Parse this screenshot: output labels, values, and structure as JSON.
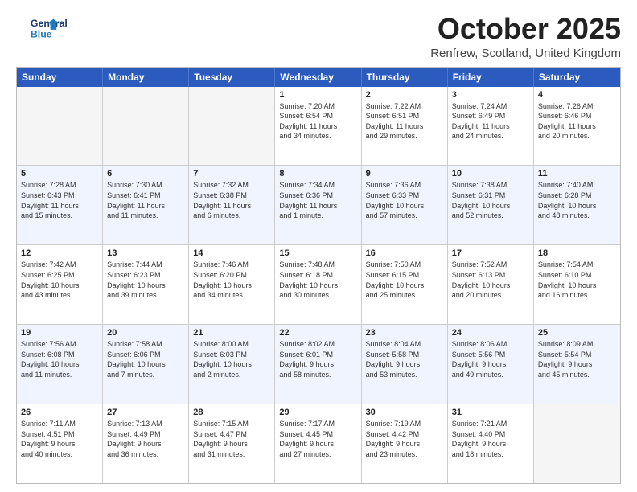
{
  "header": {
    "logo_line1": "General",
    "logo_line2": "Blue",
    "month": "October 2025",
    "location": "Renfrew, Scotland, United Kingdom"
  },
  "weekdays": [
    "Sunday",
    "Monday",
    "Tuesday",
    "Wednesday",
    "Thursday",
    "Friday",
    "Saturday"
  ],
  "rows": [
    [
      {
        "day": "",
        "info": ""
      },
      {
        "day": "",
        "info": ""
      },
      {
        "day": "",
        "info": ""
      },
      {
        "day": "1",
        "info": "Sunrise: 7:20 AM\nSunset: 6:54 PM\nDaylight: 11 hours\nand 34 minutes."
      },
      {
        "day": "2",
        "info": "Sunrise: 7:22 AM\nSunset: 6:51 PM\nDaylight: 11 hours\nand 29 minutes."
      },
      {
        "day": "3",
        "info": "Sunrise: 7:24 AM\nSunset: 6:49 PM\nDaylight: 11 hours\nand 24 minutes."
      },
      {
        "day": "4",
        "info": "Sunrise: 7:26 AM\nSunset: 6:46 PM\nDaylight: 11 hours\nand 20 minutes."
      }
    ],
    [
      {
        "day": "5",
        "info": "Sunrise: 7:28 AM\nSunset: 6:43 PM\nDaylight: 11 hours\nand 15 minutes."
      },
      {
        "day": "6",
        "info": "Sunrise: 7:30 AM\nSunset: 6:41 PM\nDaylight: 11 hours\nand 11 minutes."
      },
      {
        "day": "7",
        "info": "Sunrise: 7:32 AM\nSunset: 6:38 PM\nDaylight: 11 hours\nand 6 minutes."
      },
      {
        "day": "8",
        "info": "Sunrise: 7:34 AM\nSunset: 6:36 PM\nDaylight: 11 hours\nand 1 minute."
      },
      {
        "day": "9",
        "info": "Sunrise: 7:36 AM\nSunset: 6:33 PM\nDaylight: 10 hours\nand 57 minutes."
      },
      {
        "day": "10",
        "info": "Sunrise: 7:38 AM\nSunset: 6:31 PM\nDaylight: 10 hours\nand 52 minutes."
      },
      {
        "day": "11",
        "info": "Sunrise: 7:40 AM\nSunset: 6:28 PM\nDaylight: 10 hours\nand 48 minutes."
      }
    ],
    [
      {
        "day": "12",
        "info": "Sunrise: 7:42 AM\nSunset: 6:25 PM\nDaylight: 10 hours\nand 43 minutes."
      },
      {
        "day": "13",
        "info": "Sunrise: 7:44 AM\nSunset: 6:23 PM\nDaylight: 10 hours\nand 39 minutes."
      },
      {
        "day": "14",
        "info": "Sunrise: 7:46 AM\nSunset: 6:20 PM\nDaylight: 10 hours\nand 34 minutes."
      },
      {
        "day": "15",
        "info": "Sunrise: 7:48 AM\nSunset: 6:18 PM\nDaylight: 10 hours\nand 30 minutes."
      },
      {
        "day": "16",
        "info": "Sunrise: 7:50 AM\nSunset: 6:15 PM\nDaylight: 10 hours\nand 25 minutes."
      },
      {
        "day": "17",
        "info": "Sunrise: 7:52 AM\nSunset: 6:13 PM\nDaylight: 10 hours\nand 20 minutes."
      },
      {
        "day": "18",
        "info": "Sunrise: 7:54 AM\nSunset: 6:10 PM\nDaylight: 10 hours\nand 16 minutes."
      }
    ],
    [
      {
        "day": "19",
        "info": "Sunrise: 7:56 AM\nSunset: 6:08 PM\nDaylight: 10 hours\nand 11 minutes."
      },
      {
        "day": "20",
        "info": "Sunrise: 7:58 AM\nSunset: 6:06 PM\nDaylight: 10 hours\nand 7 minutes."
      },
      {
        "day": "21",
        "info": "Sunrise: 8:00 AM\nSunset: 6:03 PM\nDaylight: 10 hours\nand 2 minutes."
      },
      {
        "day": "22",
        "info": "Sunrise: 8:02 AM\nSunset: 6:01 PM\nDaylight: 9 hours\nand 58 minutes."
      },
      {
        "day": "23",
        "info": "Sunrise: 8:04 AM\nSunset: 5:58 PM\nDaylight: 9 hours\nand 53 minutes."
      },
      {
        "day": "24",
        "info": "Sunrise: 8:06 AM\nSunset: 5:56 PM\nDaylight: 9 hours\nand 49 minutes."
      },
      {
        "day": "25",
        "info": "Sunrise: 8:09 AM\nSunset: 5:54 PM\nDaylight: 9 hours\nand 45 minutes."
      }
    ],
    [
      {
        "day": "26",
        "info": "Sunrise: 7:11 AM\nSunset: 4:51 PM\nDaylight: 9 hours\nand 40 minutes."
      },
      {
        "day": "27",
        "info": "Sunrise: 7:13 AM\nSunset: 4:49 PM\nDaylight: 9 hours\nand 36 minutes."
      },
      {
        "day": "28",
        "info": "Sunrise: 7:15 AM\nSunset: 4:47 PM\nDaylight: 9 hours\nand 31 minutes."
      },
      {
        "day": "29",
        "info": "Sunrise: 7:17 AM\nSunset: 4:45 PM\nDaylight: 9 hours\nand 27 minutes."
      },
      {
        "day": "30",
        "info": "Sunrise: 7:19 AM\nSunset: 4:42 PM\nDaylight: 9 hours\nand 23 minutes."
      },
      {
        "day": "31",
        "info": "Sunrise: 7:21 AM\nSunset: 4:40 PM\nDaylight: 9 hours\nand 18 minutes."
      },
      {
        "day": "",
        "info": ""
      }
    ]
  ]
}
